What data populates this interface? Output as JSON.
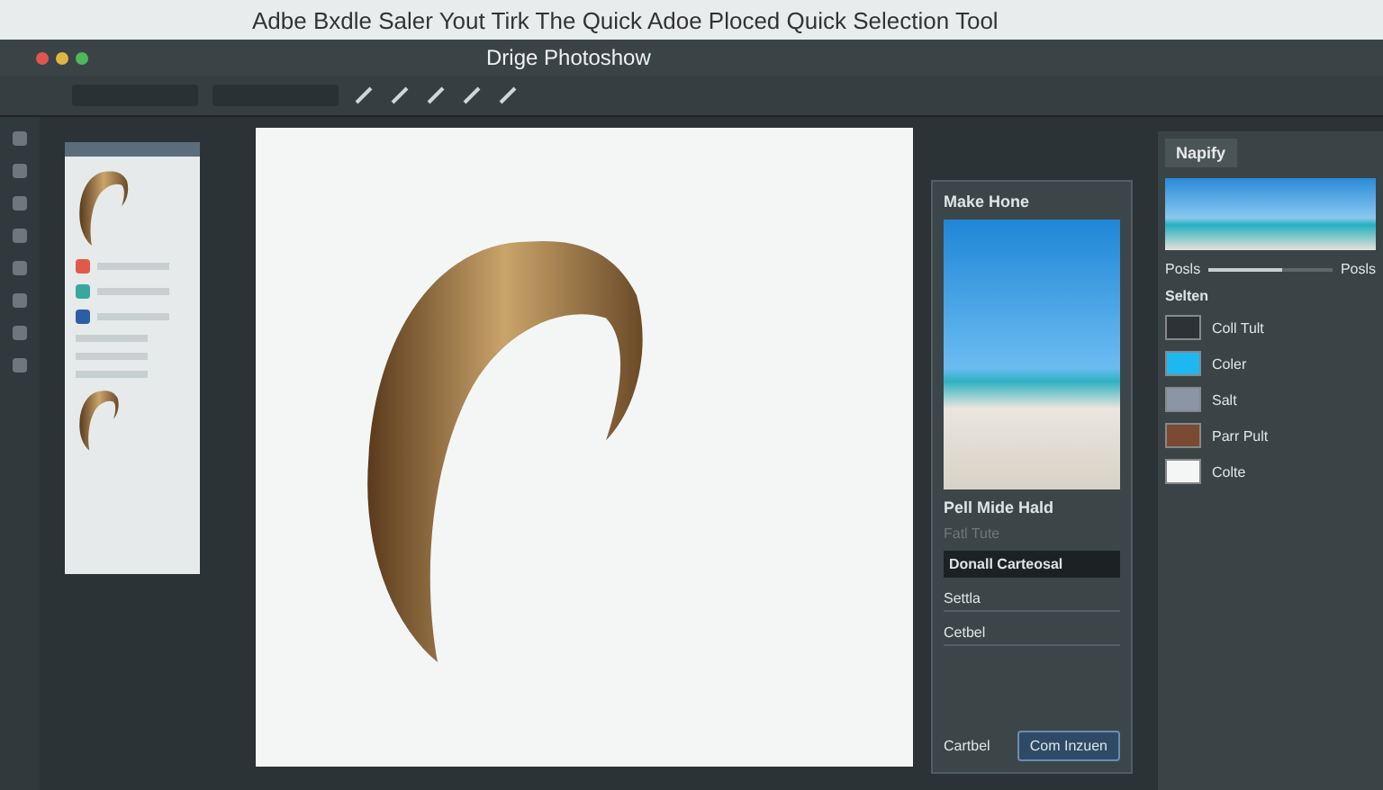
{
  "browser_title": "Adbe Bxdle Saler Yout Tirk The Quick Adoe Ploced Quick Selection Tool",
  "window": {
    "title": "Drige Photoshow"
  },
  "swatches": [
    {
      "color": "#e05a4a"
    },
    {
      "color": "#3aa6a0"
    },
    {
      "color": "#2a5fa8"
    }
  ],
  "properties": {
    "title": "Make Hone",
    "section": "Pell Mide Hald",
    "field": {
      "placeholder": "Fatl Tute"
    },
    "dropdown": "Donall Carteosal",
    "rows": [
      "Settla",
      "Cetbel"
    ],
    "cancel": "Cartbel",
    "confirm": "Com Inzuen"
  },
  "layers_panel": {
    "tab": "Napify",
    "slider": {
      "label_left": "Posls",
      "label_right": "Posls",
      "level": 0.6
    },
    "select_label": "Selten",
    "layers": [
      {
        "name": "Coll Tult",
        "color": "#2c3236"
      },
      {
        "name": "Coler",
        "color": "#1eb8f0"
      },
      {
        "name": "Salt",
        "color": "#8a96a6"
      },
      {
        "name": "Parr Pult",
        "color": "#7a4a32"
      },
      {
        "name": "Colte",
        "color": "#f4f6f6"
      }
    ]
  }
}
